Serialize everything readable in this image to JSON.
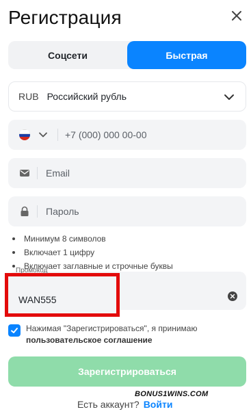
{
  "title": "Регистрация",
  "tabs": [
    {
      "label": "Соцсети",
      "active": false
    },
    {
      "label": "Быстрая",
      "active": true
    }
  ],
  "currency": {
    "code": "RUB",
    "name": "Российский рубль"
  },
  "phone": {
    "placeholder": "+7 (000) 000 00-00",
    "flag": "russia-flag-icon"
  },
  "email": {
    "placeholder": "Email",
    "icon": "mail-icon"
  },
  "password": {
    "placeholder": "Пароль",
    "icon": "lock-icon"
  },
  "password_rules": [
    "Минимум 8 символов",
    "Включает 1 цифру",
    "Включает заглавные и строчные буквы"
  ],
  "promo": {
    "label": "Промокод",
    "value": "WAN555"
  },
  "agreement": {
    "checked": true,
    "text": "Нажимая \"Зарегистрироваться\", я принимаю",
    "link": "пользовательское соглашение"
  },
  "submit_label": "Зарегистрироваться",
  "watermark": "BONUS1WINS.COM",
  "footer": {
    "question": "Есть аккаунт?",
    "login_label": "Войти"
  },
  "colors": {
    "accent": "#0a84ff",
    "submit": "#8fdcaa",
    "highlight": "#e30b0b"
  }
}
